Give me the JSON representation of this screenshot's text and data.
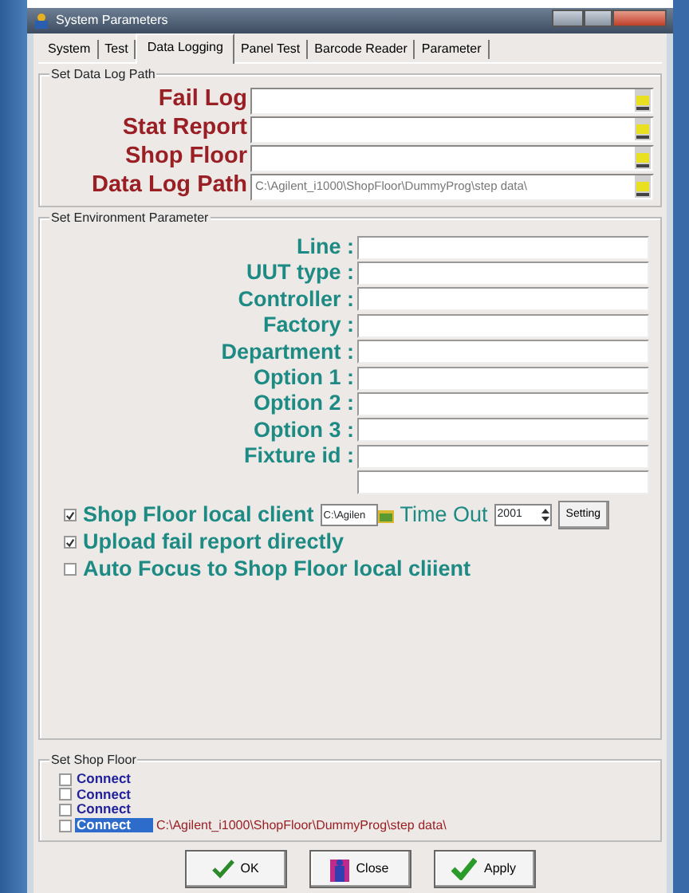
{
  "window": {
    "title": "System Parameters"
  },
  "tabs": [
    {
      "label": "System",
      "selected": false
    },
    {
      "label": "Test",
      "selected": false
    },
    {
      "label": "Data Logging",
      "selected": true
    },
    {
      "label": "Panel Test",
      "selected": false
    },
    {
      "label": "Barcode Reader",
      "selected": false
    },
    {
      "label": "Parameter",
      "selected": false
    }
  ],
  "data_log_path": {
    "title": "Set Data Log Path",
    "rows": [
      {
        "label": "Fail Log"
      },
      {
        "label": "Stat Report"
      },
      {
        "label": "Shop Floor"
      },
      {
        "label": "Data Log Path",
        "value": "C:\\Agilent_i1000\\ShopFloor\\DummyProg\\step data\\"
      }
    ]
  },
  "environment": {
    "title": "Set Environment Parameter",
    "fields": [
      {
        "kind": "labeled",
        "label": "Line :"
      },
      {
        "kind": "labeled",
        "label": "UUT type :"
      },
      {
        "kind": "labeled",
        "label": "Controller :"
      },
      {
        "kind": "labeled",
        "label": "Factory :"
      },
      {
        "kind": "labeled",
        "label": "Department :"
      },
      {
        "kind": "labeled",
        "label": "Option 1 :"
      },
      {
        "kind": "labeled",
        "label": "Option 2 :"
      },
      {
        "kind": "labeled",
        "label": "Option 3 :"
      },
      {
        "kind": "labeled",
        "label": "Fixture id :"
      },
      {
        "kind": "blank"
      }
    ],
    "options": [
      {
        "kind": "client",
        "label": "Shop Floor local client",
        "checked": true,
        "path": "C:\\Agilen",
        "time_out_label": "Time Out",
        "time_out": "2001",
        "button": "Setting"
      },
      {
        "kind": "plain",
        "label": "Upload fail report directly",
        "checked": true
      },
      {
        "kind": "plain",
        "label": "Auto Focus to Shop Floor local cliient",
        "checked": false
      }
    ]
  },
  "shop_floor": {
    "title": "Set Shop Floor",
    "connections": [
      {
        "label": "Connect",
        "checked": false,
        "selected": false
      },
      {
        "label": "Connect",
        "checked": false,
        "selected": false
      },
      {
        "label": "Connect",
        "checked": false,
        "selected": false
      },
      {
        "label": "Connect",
        "checked": false,
        "selected": true,
        "path": "C:\\Agilent_i1000\\ShopFloor\\DummyProg\\step data\\"
      }
    ]
  },
  "buttons": [
    {
      "label": "OK",
      "kind": "ok"
    },
    {
      "label": "Close",
      "kind": "close"
    },
    {
      "label": "Apply",
      "kind": "apply"
    }
  ]
}
